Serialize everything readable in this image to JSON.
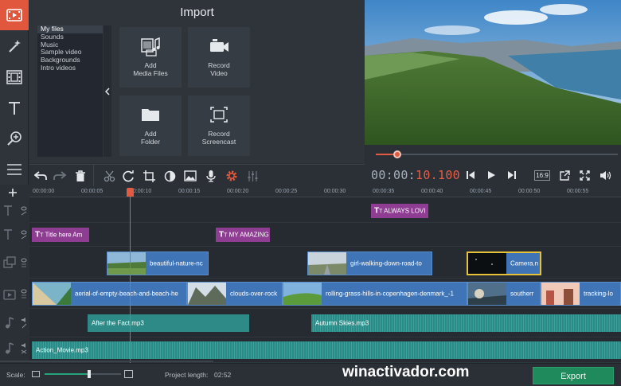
{
  "import": {
    "title": "Import",
    "categories": [
      "My files",
      "Sounds",
      "Music",
      "Sample video",
      "Backgrounds",
      "Intro videos"
    ],
    "tiles": {
      "add_media": "Add\nMedia Files",
      "record_video": "Record\nVideo",
      "add_folder": "Add\nFolder",
      "record_screencast": "Record\nScreencast"
    }
  },
  "playback": {
    "timecode_dim": "00:00:",
    "timecode_hot": "10.100",
    "aspect": "16:9",
    "seek_progress": 0.09
  },
  "ruler": [
    "00:00:00",
    "00:00:05",
    "00:00:10",
    "00:00:15",
    "00:00:20",
    "00:00:25",
    "00:00:30",
    "00:00:35",
    "00:00:40",
    "00:00:45",
    "00:00:50",
    "00:00:55"
  ],
  "titles": {
    "always": "ALWAYS LOVI",
    "title_here": "Title here Am",
    "amazing": "MY AMAZING"
  },
  "overlay_clips": {
    "beautiful": "beautiful-nature-nc",
    "girl": "girl-walking-down-road-to",
    "camera": "Camera.n"
  },
  "video_clips": {
    "aerial": "aerial-of-empty-beach-and-beach-he",
    "clouds": "clouds-over-rock",
    "rolling": "rolling-grass-hills-in-copenhagen-denmark_-1",
    "southern": "southerr",
    "tracking": "tracking-lo"
  },
  "audio_clips": {
    "after": "After the Fact.mp3",
    "autumn": "Autumn Skies.mp3",
    "action": "Action_Movie.mp3"
  },
  "bottom": {
    "scale_label": "Scale:",
    "project_length_label": "Project length:",
    "project_length_value": "02:52",
    "export_label": "Export",
    "watermark": "winactivador.com"
  },
  "colors": {
    "accent": "#e1573d",
    "video_clip": "#3f74b6",
    "title_clip": "#8e3d93",
    "audio_clip": "#2e8a86",
    "export": "#1f8a5b"
  }
}
